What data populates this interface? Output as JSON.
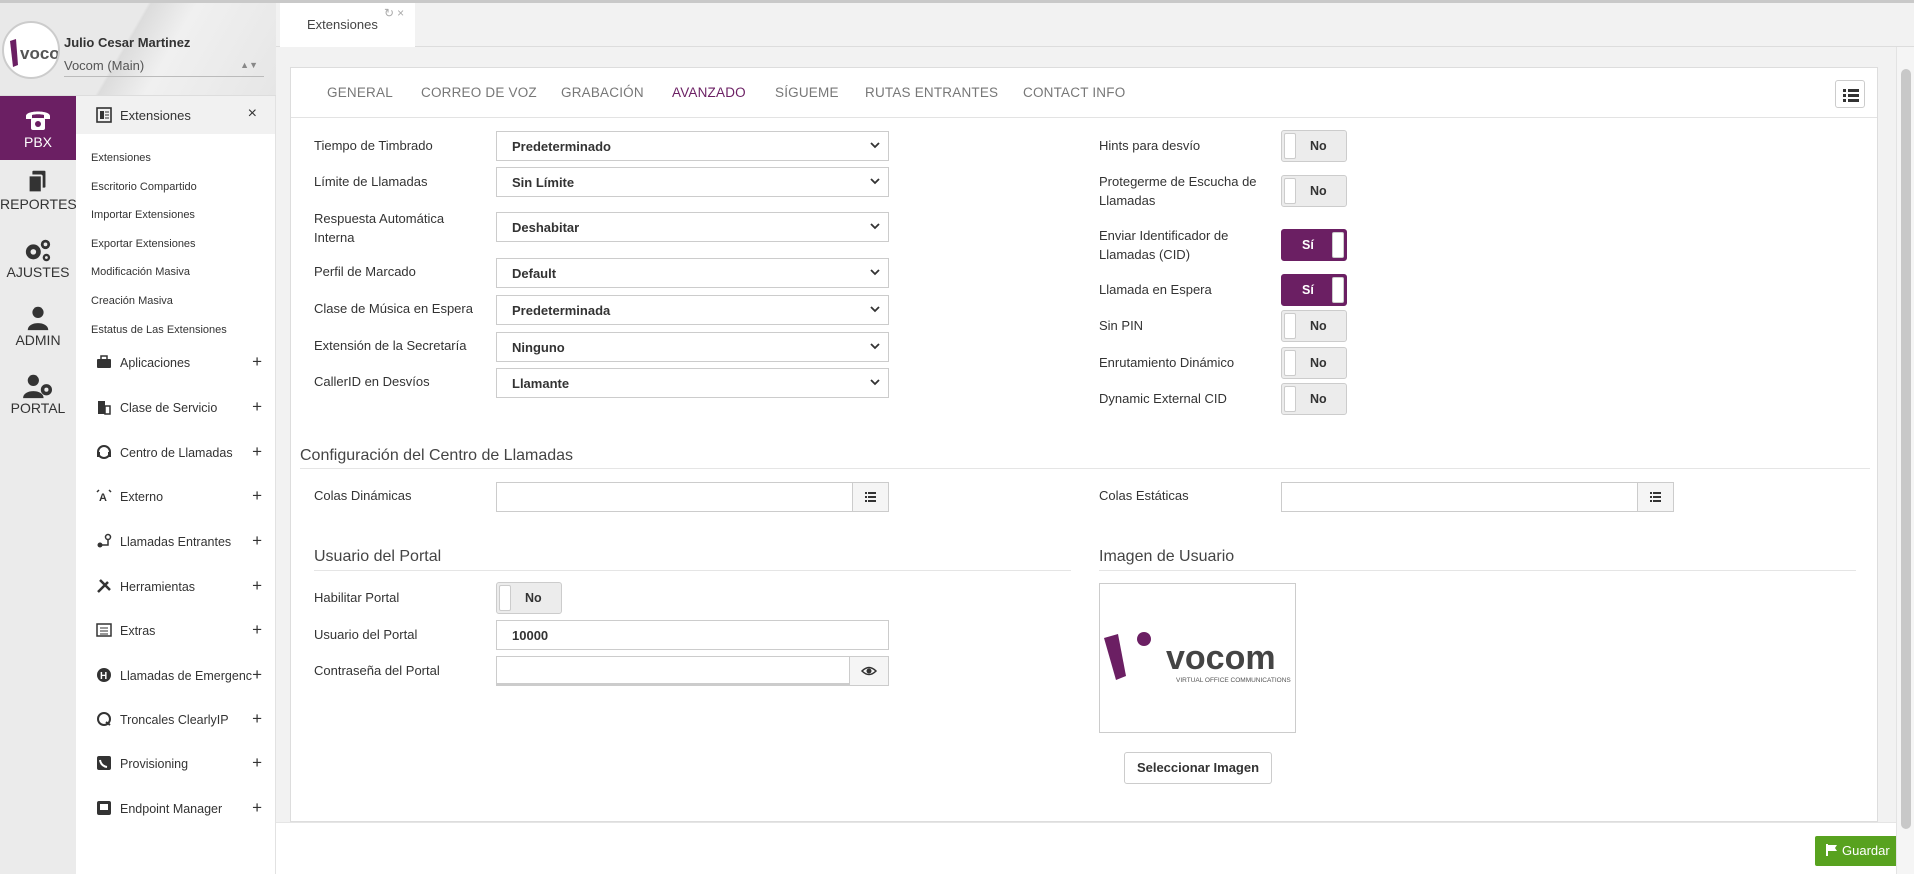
{
  "user": {
    "name": "Julio Cesar Martinez",
    "org": "Vocom (Main)",
    "logo_text": "vocom"
  },
  "rail": [
    {
      "label": "PBX",
      "icon": "phone-icon",
      "active": true
    },
    {
      "label": "REPORTES",
      "icon": "documents-icon"
    },
    {
      "label": "AJUSTES",
      "icon": "gears-icon"
    },
    {
      "label": "ADMIN",
      "icon": "user-admin-icon"
    },
    {
      "label": "PORTAL",
      "icon": "user-gear-icon"
    }
  ],
  "submenu": {
    "header": "Extensiones",
    "links": [
      "Extensiones",
      "Escritorio Compartido",
      "Importar Extensiones",
      "Exportar Extensiones",
      "Modificación Masiva",
      "Creación Masiva",
      "Estatus de Las Extensiones"
    ],
    "sections": [
      "Aplicaciones",
      "Clase de Servicio",
      "Centro de Llamadas",
      "Externo",
      "Llamadas Entrantes",
      "Herramientas",
      "Extras",
      "Llamadas de Emergencia",
      "Troncales ClearlyIP",
      "Provisioning",
      "Endpoint Manager"
    ]
  },
  "page_tab": "Extensiones",
  "tabs": [
    "GENERAL",
    "CORREO DE VOZ",
    "GRABACIÓN",
    "AVANZADO",
    "SÍGUEME",
    "RUTAS ENTRANTES",
    "CONTACT INFO"
  ],
  "active_tab": "AVANZADO",
  "left_fields": [
    {
      "label": "Tiempo de Timbrado",
      "value": "Predeterminado"
    },
    {
      "label": "Límite de Llamadas",
      "value": "Sin Límite"
    },
    {
      "label": "Respuesta Automática Interna",
      "value": "Deshabitar"
    },
    {
      "label": "Perfil de Marcado",
      "value": "Default"
    },
    {
      "label": "Clase de Música en Espera",
      "value": "Predeterminada"
    },
    {
      "label": "Extensión de la Secretaría",
      "value": "Ninguno"
    },
    {
      "label": "CallerID en Desvíos",
      "value": "Llamante"
    }
  ],
  "right_toggles": [
    {
      "label": "Hints para desvío",
      "value": "No"
    },
    {
      "label": "Protegerme de Escucha de Llamadas",
      "value": "No"
    },
    {
      "label": "Enviar Identificador de Llamadas (CID)",
      "value": "Sí"
    },
    {
      "label": "Llamada en Espera",
      "value": "Sí"
    },
    {
      "label": "Sin PIN",
      "value": "No"
    },
    {
      "label": "Enrutamiento Dinámico",
      "value": "No"
    },
    {
      "label": "Dynamic External CID",
      "value": "No"
    }
  ],
  "callcenter": {
    "title": "Configuración del Centro de Llamadas",
    "dynamic_label": "Colas Dinámicas",
    "static_label": "Colas Estáticas"
  },
  "portal": {
    "title": "Usuario del Portal",
    "enable_label": "Habilitar Portal",
    "enable_value": "No",
    "user_label": "Usuario del Portal",
    "user_value": "10000",
    "password_label": "Contraseña del Portal"
  },
  "image": {
    "title": "Imagen de Usuario",
    "logo_text": "vocom",
    "logo_sub": "VIRTUAL OFFICE COMMUNICATIONS",
    "select_label": "Seleccionar Imagen"
  },
  "save_label": "Guardar",
  "colors": {
    "brand": "#6b1f63",
    "save": "#58a21f"
  }
}
